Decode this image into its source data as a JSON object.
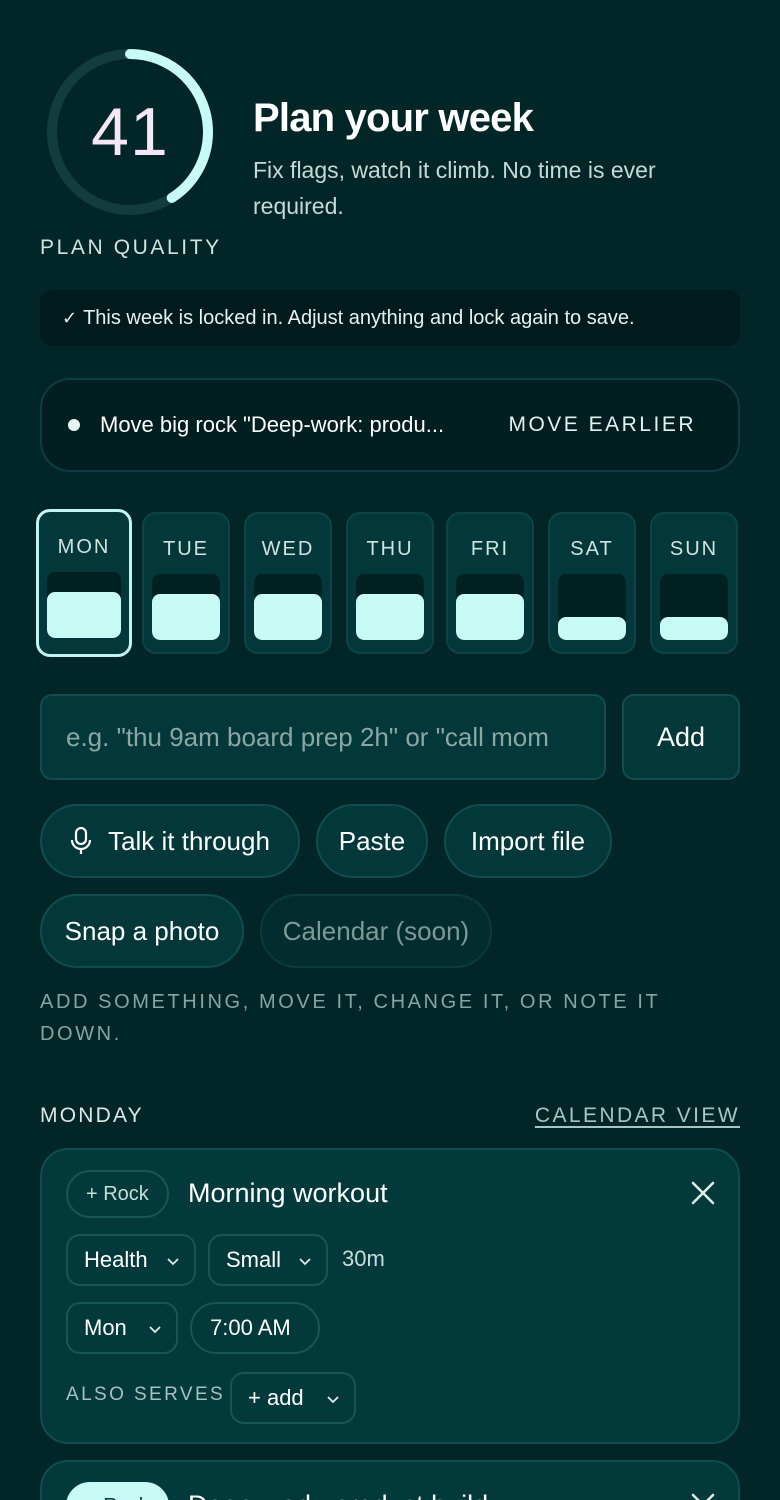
{
  "header": {
    "score": "41",
    "score_fraction": 0.41,
    "quality_label": "PLAN QUALITY",
    "title": "Plan your week",
    "subtitle": "Fix flags, watch it climb. No time is ever required."
  },
  "banner": {
    "check": "✓",
    "text": "This week is locked in. Adjust anything and lock again to save."
  },
  "suggestion": {
    "text": "Move big rock \"Deep-work: produ...",
    "action": "MOVE EARLIER"
  },
  "days": [
    {
      "label": "MON",
      "fill": 0.7,
      "selected": true
    },
    {
      "label": "TUE",
      "fill": 0.7,
      "selected": false
    },
    {
      "label": "WED",
      "fill": 0.7,
      "selected": false
    },
    {
      "label": "THU",
      "fill": 0.7,
      "selected": false
    },
    {
      "label": "FRI",
      "fill": 0.7,
      "selected": false
    },
    {
      "label": "SAT",
      "fill": 0.35,
      "selected": false
    },
    {
      "label": "SUN",
      "fill": 0.35,
      "selected": false
    }
  ],
  "quick_add": {
    "placeholder": "e.g. \"thu 9am board prep 2h\" or \"call mom",
    "add_label": "Add"
  },
  "actions": {
    "talk": "Talk it through",
    "paste": "Paste",
    "import": "Import file",
    "photo": "Snap a photo",
    "calendar": "Calendar (soon)"
  },
  "hint": "ADD SOMETHING, MOVE IT, CHANGE IT, OR NOTE IT DOWN.",
  "section": {
    "title": "MONDAY",
    "calendar_link": "CALENDAR VIEW"
  },
  "events": [
    {
      "rock": "+ Rock",
      "title": "Morning workout",
      "area": "Health",
      "size": "Small",
      "duration": "30m",
      "day": "Mon",
      "time": "7:00 AM",
      "also_serves_label": "ALSO SERVES",
      "also_serves_value": "+ add"
    },
    {
      "rock": "+ Rock",
      "title": "Deep-work: product build"
    }
  ],
  "colors": {
    "background": "#022628",
    "accent": "#c8fbf6",
    "card": "#023a3b"
  }
}
